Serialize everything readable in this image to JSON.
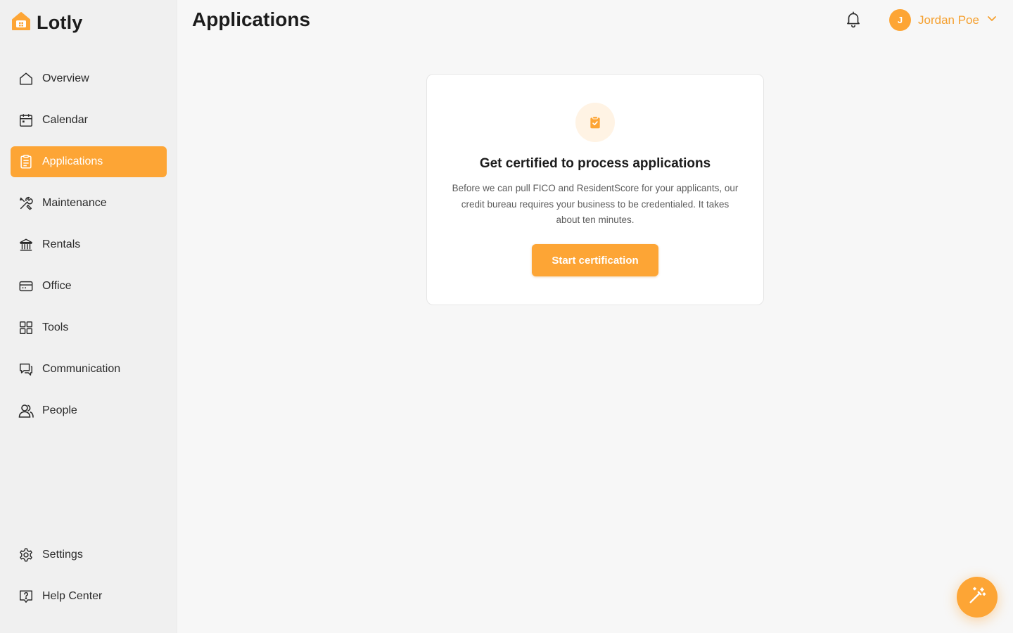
{
  "app": {
    "name": "Lotly"
  },
  "header": {
    "title": "Applications"
  },
  "user": {
    "initial": "J",
    "name": "Jordan Poe"
  },
  "sidebar": {
    "items": [
      {
        "label": "Overview",
        "icon": "home-icon"
      },
      {
        "label": "Calendar",
        "icon": "calendar-icon"
      },
      {
        "label": "Applications",
        "icon": "clipboard-icon",
        "active": true
      },
      {
        "label": "Maintenance",
        "icon": "tools-icon"
      },
      {
        "label": "Rentals",
        "icon": "bank-icon"
      },
      {
        "label": "Office",
        "icon": "wallet-icon"
      },
      {
        "label": "Tools",
        "icon": "grid-icon"
      },
      {
        "label": "Communication",
        "icon": "chat-icon"
      },
      {
        "label": "People",
        "icon": "users-icon"
      }
    ],
    "bottom_items": [
      {
        "label": "Settings",
        "icon": "gear-icon"
      },
      {
        "label": "Help Center",
        "icon": "help-icon"
      }
    ]
  },
  "card": {
    "title": "Get certified to process applications",
    "description": "Before we can pull FICO and ResidentScore for your applicants, our credit bureau requires your business to be credentialed. It takes about ten minutes.",
    "button_label": "Start certification"
  },
  "colors": {
    "accent": "#fda535",
    "accent_text": "#f5a02f",
    "background": "#f7f7f7",
    "sidebar": "#f0f0f0"
  }
}
